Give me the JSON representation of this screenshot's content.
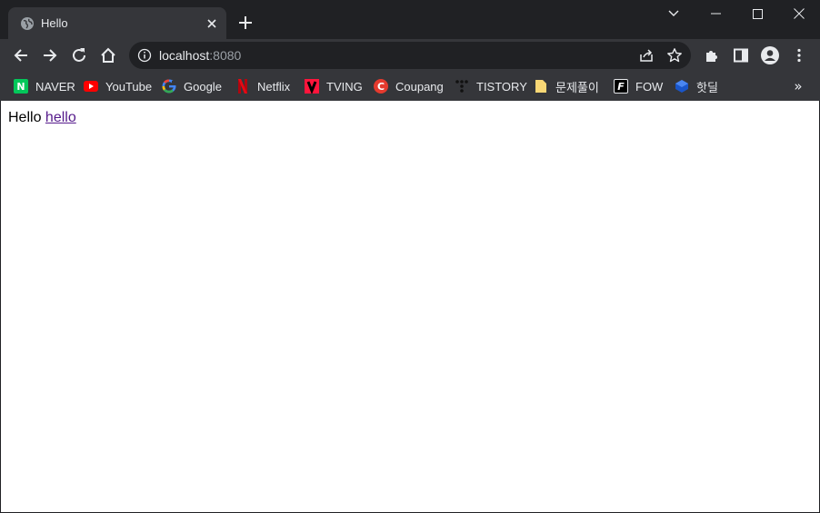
{
  "tab": {
    "title": "Hello"
  },
  "omnibox": {
    "host": "localhost",
    "port": ":8080"
  },
  "bookmarks": [
    {
      "label": "NAVER",
      "icon": "naver-icon",
      "color": "#03c75a"
    },
    {
      "label": "YouTube",
      "icon": "youtube-icon",
      "color": "#ff0000"
    },
    {
      "label": "Google",
      "icon": "google-icon",
      "color": "#4285f4"
    },
    {
      "label": "Netflix",
      "icon": "netflix-icon",
      "color": "#e50914"
    },
    {
      "label": "TVING",
      "icon": "tving-icon",
      "color": "#ff153c"
    },
    {
      "label": "Coupang",
      "icon": "coupang-icon",
      "color": "#e53a2e"
    },
    {
      "label": "TISTORY",
      "icon": "tistory-icon",
      "color": "#000000"
    },
    {
      "label": "문제풀이",
      "icon": "folder-icon",
      "color": "#f8d775"
    },
    {
      "label": "FOW",
      "icon": "fow-icon",
      "color": "#000000"
    },
    {
      "label": "핫딜",
      "icon": "hotdeal-icon",
      "color": "#1a56c9"
    }
  ],
  "page": {
    "text": "Hello",
    "link": "hello"
  }
}
